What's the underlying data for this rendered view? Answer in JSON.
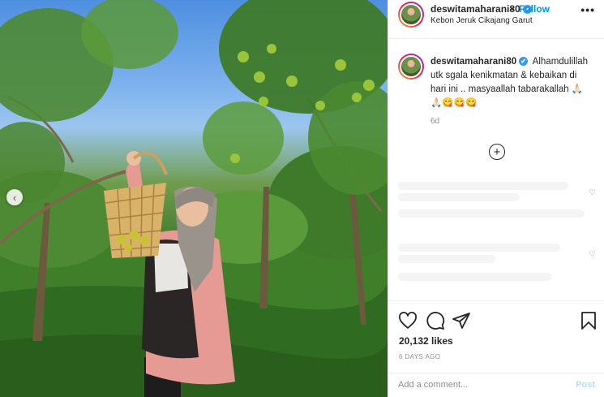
{
  "post": {
    "username": "deswitamaharani80",
    "follow_label": "Follow",
    "dot": "•",
    "location": "Kebon Jeruk Cikajang Garut",
    "more_icon": "•••"
  },
  "caption": {
    "username": "deswitamaharani80",
    "text": "Alhamdulillah utk sgala kenikmatan & kebaikan di hari ini .. masyaallah tabarakallah 🙏🏻",
    "emoji_line": "🙏🏻😋😋😋",
    "age": "6d"
  },
  "comments": {
    "load_more_icon": "+"
  },
  "actions": {
    "likes": "20,132 likes",
    "posted": "6 DAYS AGO",
    "comment_placeholder": "Add a comment...",
    "post_label": "Post"
  },
  "icons": {
    "verified": "✔",
    "carousel_prev": "‹",
    "small_heart": "♡"
  },
  "colors": {
    "accent": "#0095f6",
    "verified": "#3897f0",
    "post_disabled": "#b2dffc"
  }
}
